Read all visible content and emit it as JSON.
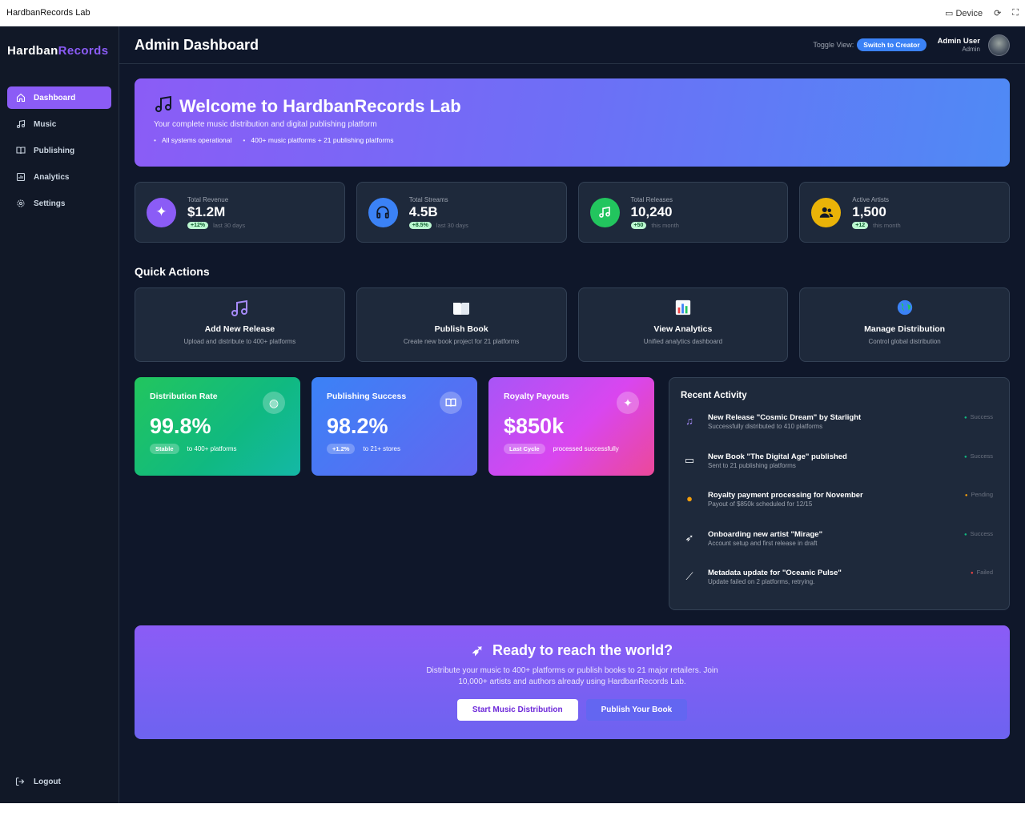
{
  "window": {
    "title": "HardbanRecords Lab",
    "device_label": "Device"
  },
  "sidebar": {
    "logo_main": "Hardban",
    "logo_accent": "Records",
    "items": [
      {
        "label": "Dashboard",
        "icon": "home-icon"
      },
      {
        "label": "Music",
        "icon": "music-icon"
      },
      {
        "label": "Publishing",
        "icon": "book-icon"
      },
      {
        "label": "Analytics",
        "icon": "chart-icon"
      },
      {
        "label": "Settings",
        "icon": "gear-icon"
      }
    ],
    "logout": "Logout"
  },
  "header": {
    "title": "Admin Dashboard",
    "toggle_label": "Toggle View:",
    "toggle_button": "Switch to Creator",
    "user_name": "Admin User",
    "user_role": "Admin"
  },
  "banner": {
    "title": "Welcome to HardbanRecords Lab",
    "subtitle": "Your complete music distribution and digital publishing platform",
    "status": "All systems operational",
    "platforms": "400+ music platforms + 21 publishing platforms"
  },
  "stats": [
    {
      "label": "Total Revenue",
      "value": "$1.2M",
      "badge": "+12%",
      "note": "last 30 days",
      "color": "#8b5cf6"
    },
    {
      "label": "Total Streams",
      "value": "4.5B",
      "badge": "+8.5%",
      "note": "last 30 days",
      "color": "#3b82f6"
    },
    {
      "label": "Total Releases",
      "value": "10,240",
      "badge": "+50",
      "note": "this month",
      "color": "#22c55e"
    },
    {
      "label": "Active Artists",
      "value": "1,500",
      "badge": "+12",
      "note": "this month",
      "color": "#eab308"
    }
  ],
  "quick_actions": {
    "title": "Quick Actions",
    "items": [
      {
        "title": "Add New Release",
        "desc": "Upload and distribute to 400+ platforms"
      },
      {
        "title": "Publish Book",
        "desc": "Create new book project for 21 platforms"
      },
      {
        "title": "View Analytics",
        "desc": "Unified analytics dashboard"
      },
      {
        "title": "Manage Distribution",
        "desc": "Control global distribution"
      }
    ]
  },
  "metrics": [
    {
      "title": "Distribution Rate",
      "value": "99.8%",
      "pill": "Stable",
      "note": "to 400+ platforms"
    },
    {
      "title": "Publishing Success",
      "value": "98.2%",
      "pill": "+1.2%",
      "note": "to 21+ stores"
    },
    {
      "title": "Royalty Payouts",
      "value": "$850k",
      "pill": "Last Cycle",
      "note": "processed successfully"
    }
  ],
  "activity": {
    "title": "Recent Activity",
    "items": [
      {
        "title": "New Release \"Cosmic Dream\" by Starlight",
        "desc": "Successfully distributed to 410 platforms",
        "status": "Success"
      },
      {
        "title": "New Book \"The Digital Age\" published",
        "desc": "Sent to 21 publishing platforms",
        "status": "Success"
      },
      {
        "title": "Royalty payment processing for November",
        "desc": "Payout of $850k scheduled for 12/15",
        "status": "Pending"
      },
      {
        "title": "Onboarding new artist \"Mirage\"",
        "desc": "Account setup and first release in draft",
        "status": "Success"
      },
      {
        "title": "Metadata update for \"Oceanic Pulse\"",
        "desc": "Update failed on 2 platforms, retrying.",
        "status": "Failed"
      }
    ]
  },
  "cta": {
    "title": "Ready to reach the world?",
    "text": "Distribute your music to 400+ platforms or publish books to 21 major retailers. Join 10,000+ artists and authors already using HardbanRecords Lab.",
    "primary": "Start Music Distribution",
    "secondary": "Publish Your Book"
  }
}
